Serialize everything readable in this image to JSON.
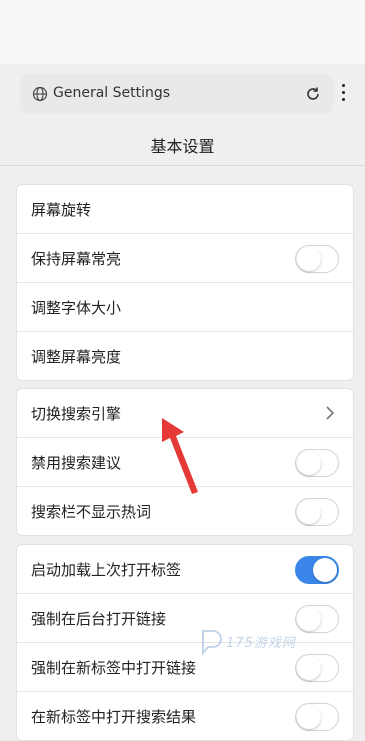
{
  "browser": {
    "url_text": "General Settings",
    "globe_icon": "globe-icon",
    "reload_icon": "reload-icon",
    "menu_icon": "more-vertical-icon"
  },
  "page": {
    "title": "基本设置"
  },
  "groups": [
    {
      "items": [
        {
          "label": "屏幕旋转",
          "control": "none"
        },
        {
          "label": "保持屏幕常亮",
          "control": "toggle",
          "on": false
        },
        {
          "label": "调整字体大小",
          "control": "none"
        },
        {
          "label": "调整屏幕亮度",
          "control": "none"
        }
      ]
    },
    {
      "items": [
        {
          "label": "切换搜索引擎",
          "control": "chevron"
        },
        {
          "label": "禁用搜索建议",
          "control": "toggle",
          "on": false
        },
        {
          "label": "搜索栏不显示热词",
          "control": "toggle",
          "on": false
        }
      ]
    },
    {
      "items": [
        {
          "label": "启动加载上次打开标签",
          "control": "toggle",
          "on": true
        },
        {
          "label": "强制在后台打开链接",
          "control": "toggle",
          "on": false
        },
        {
          "label": "强制在新标签中打开链接",
          "control": "toggle",
          "on": false
        },
        {
          "label": "在新标签中打开搜索结果",
          "control": "toggle",
          "on": false
        }
      ]
    }
  ],
  "colors": {
    "toggle_on": "#3a86e8",
    "arrow": "#e53935"
  },
  "watermark": {
    "text": "175游戏网"
  }
}
